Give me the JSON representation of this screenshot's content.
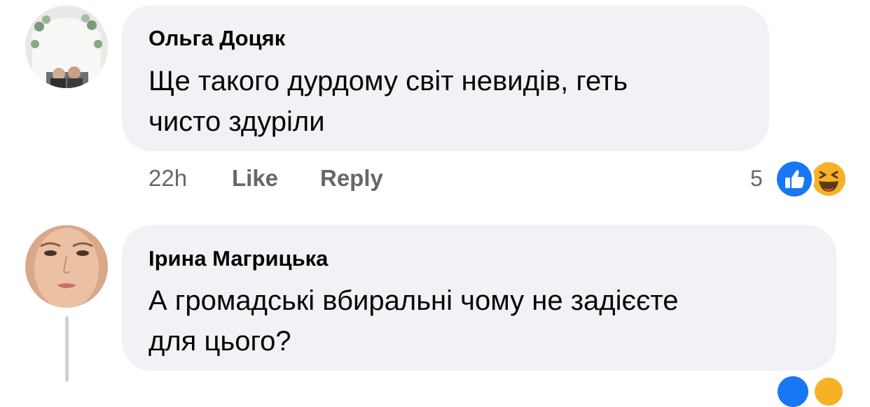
{
  "comments": [
    {
      "author": "Ольга Доцяк",
      "text_line1": "Ще такого дурдому світ невидів, геть",
      "text_line2": "чисто здуріли",
      "time": "22h",
      "like_label": "Like",
      "reply_label": "Reply",
      "reaction_count": "5",
      "reactions": [
        "like-icon",
        "haha-icon"
      ]
    },
    {
      "author": "Ірина Магрицька",
      "text_line1": "А громадські вбиральні чому не задієєте",
      "text_line2": "для цього?"
    }
  ],
  "colors": {
    "bubble": "#f0f2f5",
    "secondary_text": "#65676b",
    "like_blue": "#1877f2",
    "haha_yellow": "#f7b125"
  }
}
